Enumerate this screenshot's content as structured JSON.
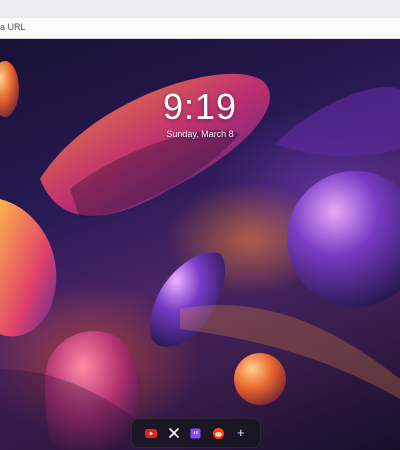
{
  "browser": {
    "address_placeholder": "a URL"
  },
  "lockscreen": {
    "time": "9:19",
    "date": "Sunday, March 8"
  },
  "dock": {
    "items": [
      {
        "icon": "youtube-icon",
        "color": "#e62117"
      },
      {
        "icon": "x-icon",
        "color": "#ffffff"
      },
      {
        "icon": "twitch-icon",
        "color": "#9147ff"
      },
      {
        "icon": "reddit-icon",
        "color": "#ff4500"
      },
      {
        "icon": "plus-icon",
        "label": "+"
      }
    ]
  }
}
